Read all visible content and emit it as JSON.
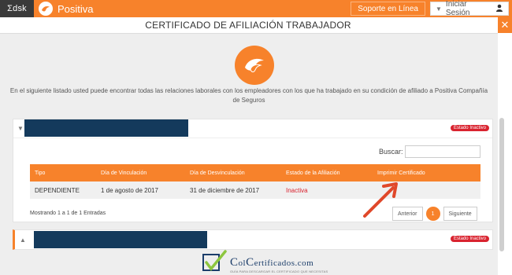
{
  "topbar": {
    "brand_short": "Σdsk",
    "brand_name": "Positiva",
    "support_label": "Soporte en Línea",
    "login_label": "Iniciar Sesión"
  },
  "modal": {
    "title": "CERTIFICADO DE AFILIACIÓN TRABAJADOR",
    "intro": "En el siguiente listado usted puede encontrar todas las relaciones laborales con los empleadores con los que ha trabajado en su condición de afiliado a Positiva Compañía de Seguros"
  },
  "cards": [
    {
      "status": "Estado Inactivo",
      "search_label": "Buscar:",
      "search_value": "",
      "table": {
        "headers": [
          "Tipo",
          "Día de Vinculación",
          "Día de Desvinculación",
          "Estado de la Afiliación",
          "Imprimir Certificado"
        ],
        "rows": [
          [
            "DEPENDIENTE",
            "1 de agosto de 2017",
            "31 de diciembre de 2017",
            "Inactiva",
            ""
          ]
        ]
      },
      "showing": "Mostrando 1 a 1 de 1 Entradas",
      "pager": {
        "prev": "Anterior",
        "page": "1",
        "next": "Siguiente"
      }
    },
    {
      "status": "Estado Inactivo"
    }
  ],
  "watermark": {
    "main_prefix": "C",
    "main_rest": "ol",
    "main_prefix2": "C",
    "main_rest2": "ertificados.com",
    "sub": "GUÍA PARA DESCARGAR EL CERTIFICADO QUE NECESITAS"
  },
  "colors": {
    "accent": "#f7822b",
    "status_red": "#d9232f",
    "redacted": "#143a5c"
  },
  "icons": [
    "user-icon",
    "close-icon",
    "positiva-logo-icon",
    "caret-down-icon",
    "caret-up-icon",
    "check-icon"
  ]
}
